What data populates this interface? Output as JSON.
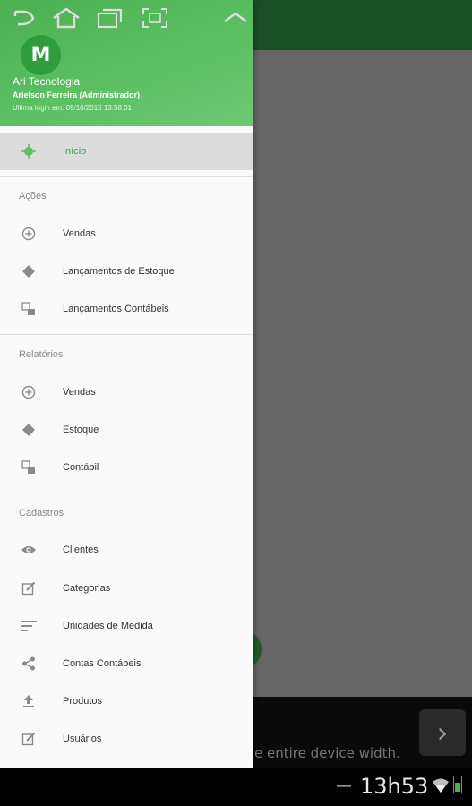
{
  "header": {
    "avatar_letter": "M",
    "company": "Ari Tecnologia",
    "user": "Arielson Ferreira (Administrador)",
    "last_login": "Ultima login em: 09/10/2015 13:58:01"
  },
  "menu": {
    "home": {
      "label": "Início",
      "icon": "crosshair-icon"
    },
    "sections": [
      {
        "title": "Ações",
        "items": [
          {
            "label": "Vendas",
            "icon": "plus-circle-icon"
          },
          {
            "label": "Lançamentos de Estoque",
            "icon": "diamond-icon"
          },
          {
            "label": "Lançamentos Contábeis",
            "icon": "ledger-icon"
          }
        ]
      },
      {
        "title": "Relatórios",
        "items": [
          {
            "label": "Vendas",
            "icon": "plus-circle-icon"
          },
          {
            "label": "Estoque",
            "icon": "diamond-icon"
          },
          {
            "label": "Contábil",
            "icon": "ledger-icon"
          }
        ]
      },
      {
        "title": "Cadastros",
        "items": [
          {
            "label": "Clientes",
            "icon": "eye-icon"
          },
          {
            "label": "Categorias",
            "icon": "edit-icon"
          },
          {
            "label": "Unidades de Medida",
            "icon": "sort-lines-icon"
          },
          {
            "label": "Contas Contábeis",
            "icon": "share-icon"
          },
          {
            "label": "Produtos",
            "icon": "upload-icon"
          },
          {
            "label": "Usuários",
            "icon": "edit-icon"
          }
        ]
      }
    ]
  },
  "background": {
    "bottom_text": "e entire device width."
  },
  "statusbar": {
    "clock": "13h53",
    "battery_level": 0.6
  },
  "colors": {
    "accent": "#4caf50",
    "active_bg": "#dcdcdc",
    "topbar": "#1b4f24"
  }
}
